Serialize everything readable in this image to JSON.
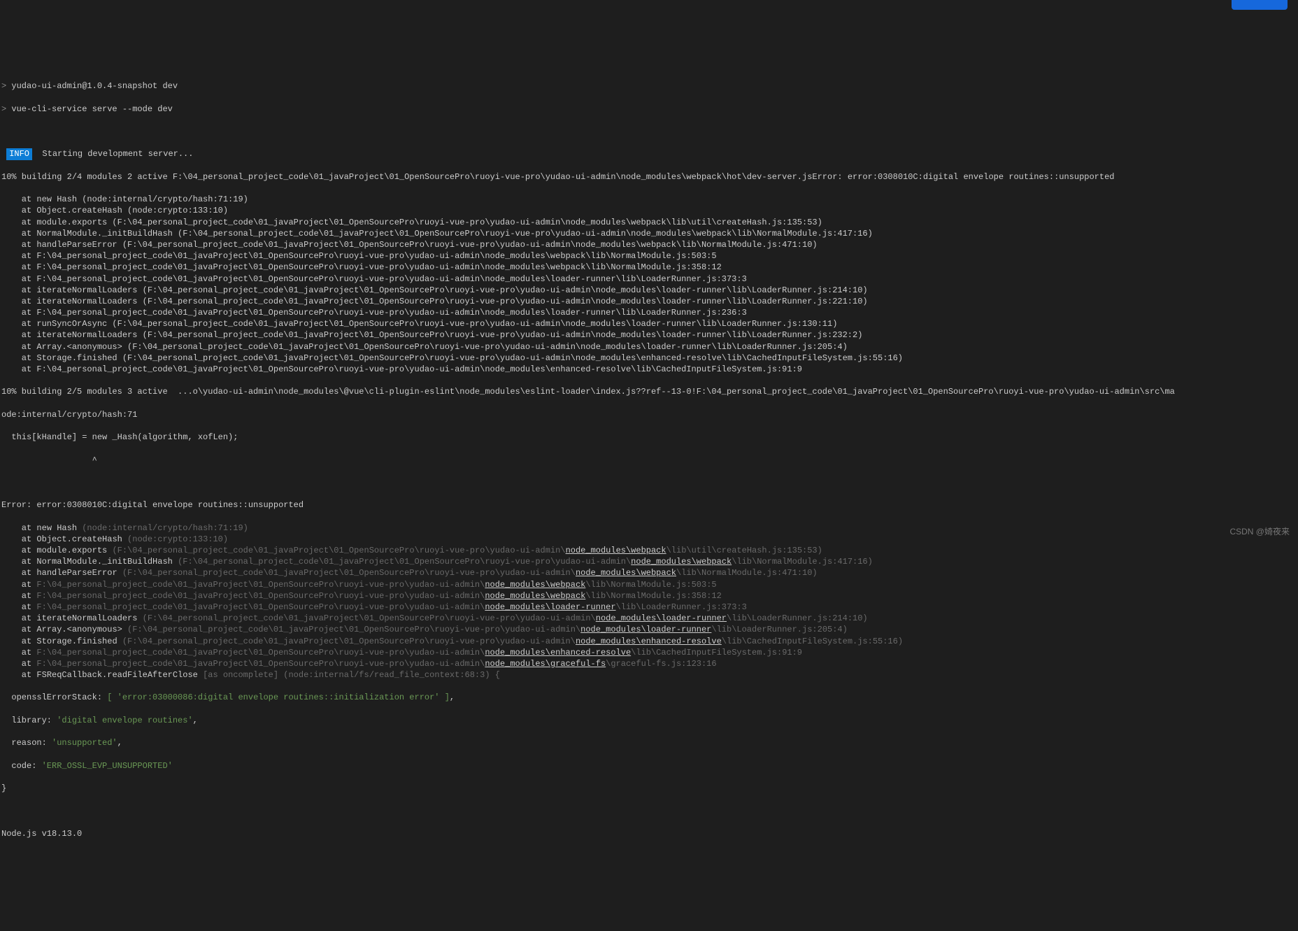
{
  "header": {
    "line1_prefix": "> ",
    "line1": "yudao-ui-admin@1.0.4-snapshot dev",
    "line2_prefix": "> ",
    "line2": "vue-cli-service serve --mode dev"
  },
  "info": {
    "tag": "INFO",
    "text": "  Starting development server..."
  },
  "build1": {
    "prefix": "10% building 2/4 modules 2 active ",
    "path": "F:\\04_personal_project_code\\01_javaProject\\01_OpenSourcePro\\ruoyi-vue-pro\\yudao-ui-admin\\node_modules\\webpack\\hot\\dev-server.js",
    "error": "Error: error:0308010C:digital envelope routines::unsupported"
  },
  "stack1": [
    "    at new Hash (node:internal/crypto/hash:71:19)",
    "    at Object.createHash (node:crypto:133:10)",
    "    at module.exports (F:\\04_personal_project_code\\01_javaProject\\01_OpenSourcePro\\ruoyi-vue-pro\\yudao-ui-admin\\node_modules\\webpack\\lib\\util\\createHash.js:135:53)",
    "    at NormalModule._initBuildHash (F:\\04_personal_project_code\\01_javaProject\\01_OpenSourcePro\\ruoyi-vue-pro\\yudao-ui-admin\\node_modules\\webpack\\lib\\NormalModule.js:417:16)",
    "    at handleParseError (F:\\04_personal_project_code\\01_javaProject\\01_OpenSourcePro\\ruoyi-vue-pro\\yudao-ui-admin\\node_modules\\webpack\\lib\\NormalModule.js:471:10)",
    "    at F:\\04_personal_project_code\\01_javaProject\\01_OpenSourcePro\\ruoyi-vue-pro\\yudao-ui-admin\\node_modules\\webpack\\lib\\NormalModule.js:503:5",
    "    at F:\\04_personal_project_code\\01_javaProject\\01_OpenSourcePro\\ruoyi-vue-pro\\yudao-ui-admin\\node_modules\\webpack\\lib\\NormalModule.js:358:12",
    "    at F:\\04_personal_project_code\\01_javaProject\\01_OpenSourcePro\\ruoyi-vue-pro\\yudao-ui-admin\\node_modules\\loader-runner\\lib\\LoaderRunner.js:373:3",
    "    at iterateNormalLoaders (F:\\04_personal_project_code\\01_javaProject\\01_OpenSourcePro\\ruoyi-vue-pro\\yudao-ui-admin\\node_modules\\loader-runner\\lib\\LoaderRunner.js:214:10)",
    "    at iterateNormalLoaders (F:\\04_personal_project_code\\01_javaProject\\01_OpenSourcePro\\ruoyi-vue-pro\\yudao-ui-admin\\node_modules\\loader-runner\\lib\\LoaderRunner.js:221:10)",
    "    at F:\\04_personal_project_code\\01_javaProject\\01_OpenSourcePro\\ruoyi-vue-pro\\yudao-ui-admin\\node_modules\\loader-runner\\lib\\LoaderRunner.js:236:3",
    "    at runSyncOrAsync (F:\\04_personal_project_code\\01_javaProject\\01_OpenSourcePro\\ruoyi-vue-pro\\yudao-ui-admin\\node_modules\\loader-runner\\lib\\LoaderRunner.js:130:11)",
    "    at iterateNormalLoaders (F:\\04_personal_project_code\\01_javaProject\\01_OpenSourcePro\\ruoyi-vue-pro\\yudao-ui-admin\\node_modules\\loader-runner\\lib\\LoaderRunner.js:232:2)",
    "    at Array.<anonymous> (F:\\04_personal_project_code\\01_javaProject\\01_OpenSourcePro\\ruoyi-vue-pro\\yudao-ui-admin\\node_modules\\loader-runner\\lib\\LoaderRunner.js:205:4)",
    "    at Storage.finished (F:\\04_personal_project_code\\01_javaProject\\01_OpenSourcePro\\ruoyi-vue-pro\\yudao-ui-admin\\node_modules\\enhanced-resolve\\lib\\CachedInputFileSystem.js:55:16)",
    "    at F:\\04_personal_project_code\\01_javaProject\\01_OpenSourcePro\\ruoyi-vue-pro\\yudao-ui-admin\\node_modules\\enhanced-resolve\\lib\\CachedInputFileSystem.js:91:9"
  ],
  "build2": {
    "line1": "10% building 2/5 modules 3 active  ...o\\yudao-ui-admin\\node_modules\\@vue\\cli-plugin-eslint\\node_modules\\eslint-loader\\index.js??ref--13-0!F:\\04_personal_project_code\\01_javaProject\\01_OpenSourcePro\\ruoyi-vue-pro\\yudao-ui-admin\\src\\ma",
    "line2": "ode:internal/crypto/hash:71",
    "line3": "  this[kHandle] = new _Hash(algorithm, xofLen);",
    "line4": "                  ^"
  },
  "error2": {
    "title": "Error: error:0308010C:digital envelope routines::unsupported"
  },
  "stack2": [
    {
      "at": "    at ",
      "fn": "new Hash ",
      "dim": "(node:internal/crypto/hash:71:19)"
    },
    {
      "at": "    at ",
      "fn": "Object.createHash ",
      "dim": "(node:crypto:133:10)"
    },
    {
      "at": "    at ",
      "fn": "module.exports ",
      "dim1": "(F:\\04_personal_project_code\\01_javaProject\\01_OpenSourcePro\\ruoyi-vue-pro\\yudao-ui-admin\\",
      "link": "node_modules\\webpack",
      "dim2": "\\lib\\util\\createHash.js:135:53)"
    },
    {
      "at": "    at ",
      "fn": "NormalModule._initBuildHash ",
      "dim1": "(F:\\04_personal_project_code\\01_javaProject\\01_OpenSourcePro\\ruoyi-vue-pro\\yudao-ui-admin\\",
      "link": "node_modules\\webpack",
      "dim2": "\\lib\\NormalModule.js:417:16)"
    },
    {
      "at": "    at ",
      "fn": "handleParseError ",
      "dim1": "(F:\\04_personal_project_code\\01_javaProject\\01_OpenSourcePro\\ruoyi-vue-pro\\yudao-ui-admin\\",
      "link": "node_modules\\webpack",
      "dim2": "\\lib\\NormalModule.js:471:10)"
    },
    {
      "at": "    at ",
      "fn": "",
      "dim1": "F:\\04_personal_project_code\\01_javaProject\\01_OpenSourcePro\\ruoyi-vue-pro\\yudao-ui-admin\\",
      "link": "node_modules\\webpack",
      "dim2": "\\lib\\NormalModule.js:503:5"
    },
    {
      "at": "    at ",
      "fn": "",
      "dim1": "F:\\04_personal_project_code\\01_javaProject\\01_OpenSourcePro\\ruoyi-vue-pro\\yudao-ui-admin\\",
      "link": "node_modules\\webpack",
      "dim2": "\\lib\\NormalModule.js:358:12"
    },
    {
      "at": "    at ",
      "fn": "",
      "dim1": "F:\\04_personal_project_code\\01_javaProject\\01_OpenSourcePro\\ruoyi-vue-pro\\yudao-ui-admin\\",
      "link": "node_modules\\loader-runner",
      "dim2": "\\lib\\LoaderRunner.js:373:3"
    },
    {
      "at": "    at ",
      "fn": "iterateNormalLoaders ",
      "dim1": "(F:\\04_personal_project_code\\01_javaProject\\01_OpenSourcePro\\ruoyi-vue-pro\\yudao-ui-admin\\",
      "link": "node_modules\\loader-runner",
      "dim2": "\\lib\\LoaderRunner.js:214:10)"
    },
    {
      "at": "    at ",
      "fn": "Array.<anonymous> ",
      "dim1": "(F:\\04_personal_project_code\\01_javaProject\\01_OpenSourcePro\\ruoyi-vue-pro\\yudao-ui-admin\\",
      "link": "node_modules\\loader-runner",
      "dim2": "\\lib\\LoaderRunner.js:205:4)"
    },
    {
      "at": "    at ",
      "fn": "Storage.finished ",
      "dim1": "(F:\\04_personal_project_code\\01_javaProject\\01_OpenSourcePro\\ruoyi-vue-pro\\yudao-ui-admin\\",
      "link": "node_modules\\enhanced-resolve",
      "dim2": "\\lib\\CachedInputFileSystem.js:55:16)"
    },
    {
      "at": "    at ",
      "fn": "",
      "dim1": "F:\\04_personal_project_code\\01_javaProject\\01_OpenSourcePro\\ruoyi-vue-pro\\yudao-ui-admin\\",
      "link": "node_modules\\enhanced-resolve",
      "dim2": "\\lib\\CachedInputFileSystem.js:91:9"
    },
    {
      "at": "    at ",
      "fn": "",
      "dim1": "F:\\04_personal_project_code\\01_javaProject\\01_OpenSourcePro\\ruoyi-vue-pro\\yudao-ui-admin\\",
      "link": "node_modules\\graceful-fs",
      "dim2": "\\graceful-fs.js:123:16"
    },
    {
      "at": "    at ",
      "fn": "FSReqCallback.readFileAfterClose ",
      "dim": "[as oncomplete] (node:internal/fs/read_file_context:68:3) {"
    }
  ],
  "errObj": {
    "line1_key": "  opensslErrorStack: ",
    "line1_val": "[ 'error:03000086:digital envelope routines::initialization error' ]",
    "line1_end": ",",
    "line2_key": "  library: ",
    "line2_val": "'digital envelope routines'",
    "line2_end": ",",
    "line3_key": "  reason: ",
    "line3_val": "'unsupported'",
    "line3_end": ",",
    "line4_key": "  code: ",
    "line4_val": "'ERR_OSSL_EVP_UNSUPPORTED'",
    "close": "}"
  },
  "footer": {
    "node": "Node.js v18.13.0"
  },
  "watermark": "CSDN @婍夜来"
}
